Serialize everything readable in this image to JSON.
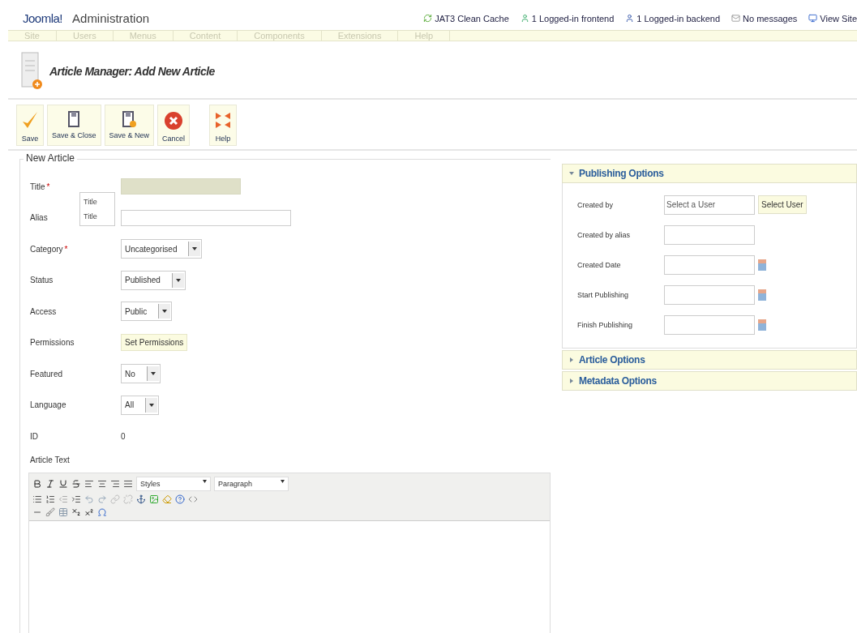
{
  "header": {
    "logo": "Joomla!",
    "title": "Administration",
    "links": [
      {
        "kind": "cache",
        "label": "JAT3 Clean Cache"
      },
      {
        "kind": "frontend",
        "label": "1 Logged-in frontend"
      },
      {
        "kind": "backend",
        "label": "1 Logged-in backend"
      },
      {
        "kind": "messages",
        "label": "No messages"
      },
      {
        "kind": "site",
        "label": "View Site"
      }
    ]
  },
  "menu": [
    {
      "label": "Site",
      "disabled": true
    },
    {
      "label": "Users",
      "disabled": true
    },
    {
      "label": "Menus",
      "disabled": true
    },
    {
      "label": "Content",
      "disabled": true
    },
    {
      "label": "Components",
      "disabled": true
    },
    {
      "label": "Extensions",
      "disabled": true
    },
    {
      "label": "Help",
      "disabled": true
    }
  ],
  "page_title": "Article Manager: Add New Article",
  "toolbar": [
    {
      "kind": "save",
      "label": "Save"
    },
    {
      "kind": "save-close",
      "label": "Save & Close"
    },
    {
      "kind": "save-new",
      "label": "Save & New"
    },
    {
      "kind": "cancel",
      "label": "Cancel"
    },
    {
      "kind": "help",
      "label": "Help"
    }
  ],
  "form": {
    "legend": "New Article",
    "tooltip": {
      "title": "Title",
      "text": "Title"
    },
    "required_mark": "*",
    "fields": [
      {
        "label": "Title",
        "required": true,
        "kind": "text",
        "focused": true
      },
      {
        "label": "Alias",
        "required": false,
        "kind": "text",
        "focused": false
      },
      {
        "label": "Category",
        "required": true,
        "kind": "select",
        "value": "Uncategorised",
        "focused": false
      },
      {
        "label": "Status",
        "required": false,
        "kind": "select",
        "value": "Published",
        "focused": false
      },
      {
        "label": "Access",
        "required": false,
        "kind": "select",
        "value": "Public",
        "focused": false
      },
      {
        "label": "Permissions",
        "required": false,
        "kind": "button",
        "value": "Set Permissions",
        "focused": false
      },
      {
        "label": "Featured",
        "required": false,
        "kind": "select",
        "value": "No",
        "focused": false
      },
      {
        "label": "Language",
        "required": false,
        "kind": "select",
        "value": "All",
        "focused": false
      },
      {
        "label": "ID",
        "required": false,
        "kind": "static",
        "value": "0",
        "focused": false
      }
    ],
    "editor": {
      "label": "Article Text",
      "styles": "Styles",
      "format": "Paragraph"
    }
  },
  "options": [
    {
      "title": "Publishing Options",
      "expanded": true,
      "fields": [
        {
          "label": "Created by",
          "kind": "user",
          "placeholder": "Select a User",
          "button": "Select User"
        },
        {
          "label": "Created by alias",
          "kind": "text"
        },
        {
          "label": "Created Date",
          "kind": "date"
        },
        {
          "label": "Start Publishing",
          "kind": "date"
        },
        {
          "label": "Finish Publishing",
          "kind": "date"
        }
      ]
    },
    {
      "title": "Article Options",
      "expanded": false
    },
    {
      "title": "Metadata Options",
      "expanded": false
    }
  ]
}
